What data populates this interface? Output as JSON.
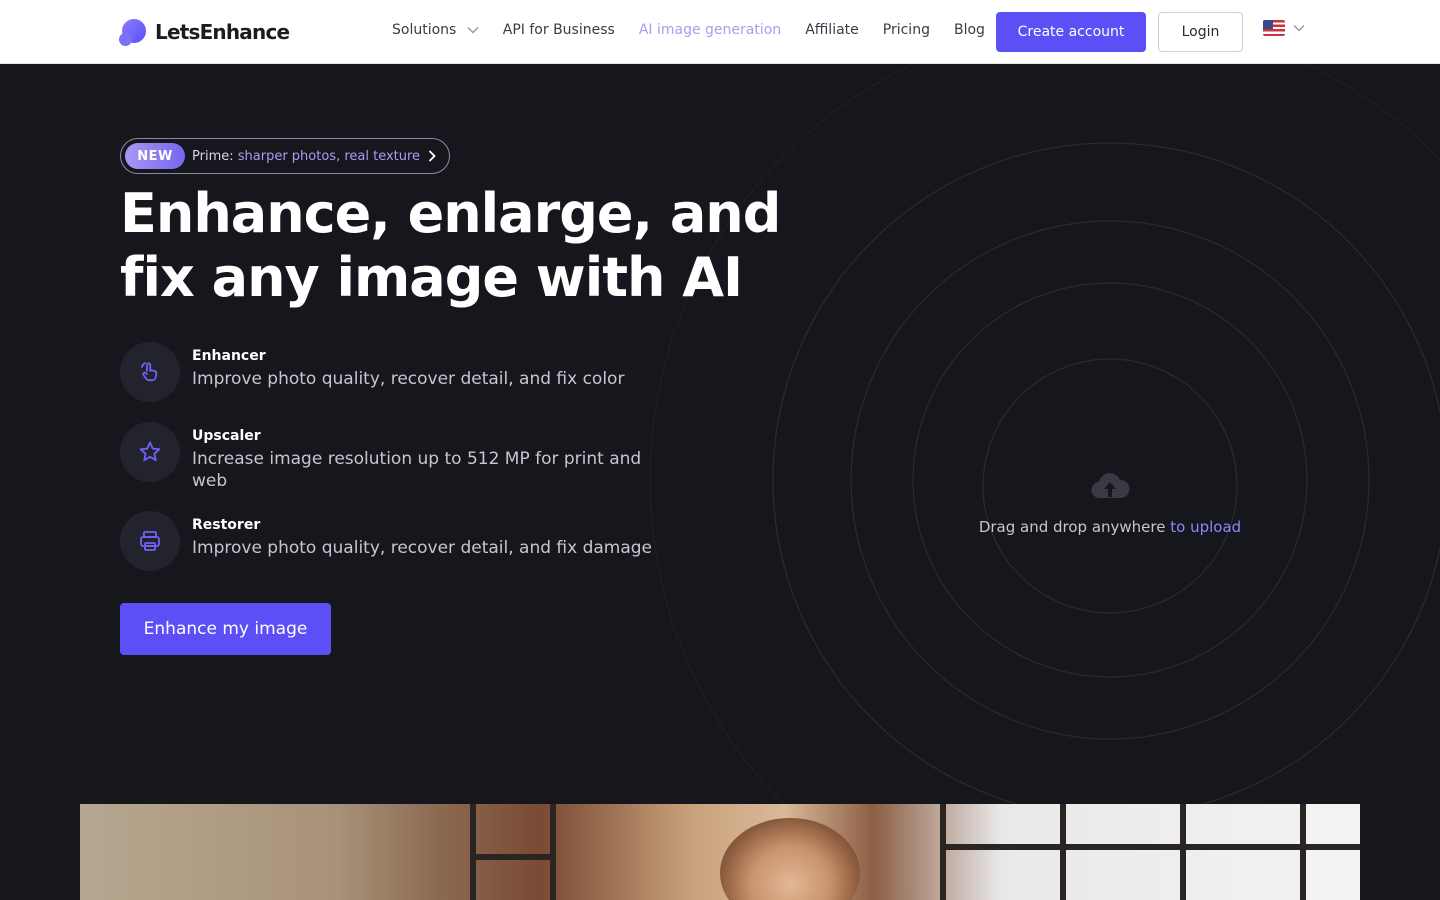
{
  "header": {
    "brand": "LetsEnhance",
    "nav": [
      {
        "label": "Solutions",
        "has_dropdown": true
      },
      {
        "label": "API for Business"
      },
      {
        "label": "AI image generation",
        "highlight": true
      },
      {
        "label": "Affiliate"
      },
      {
        "label": "Pricing"
      },
      {
        "label": "Blog"
      }
    ],
    "create_account": "Create account",
    "login": "Login",
    "language_icon": "us-flag-icon"
  },
  "hero": {
    "badge": {
      "tag": "NEW",
      "prefix": "Prime: ",
      "text": "sharper photos, real texture"
    },
    "headline": "Enhance, enlarge, and fix any image with AI",
    "features": [
      {
        "icon": "hand-pointer-icon",
        "title": "Enhancer",
        "description": "Improve photo quality, recover detail, and fix color"
      },
      {
        "icon": "star-icon",
        "title": "Upscaler",
        "description": "Increase image resolution up to 512 MP for print and web"
      },
      {
        "icon": "printer-icon",
        "title": "Restorer",
        "description": "Improve photo quality, recover detail, and fix damage"
      }
    ],
    "cta": "Enhance my image"
  },
  "upload": {
    "icon": "cloud-upload-icon",
    "text": "Drag and drop anywhere",
    "link": "to upload"
  },
  "colors": {
    "accent": "#5b4ff5",
    "background": "#16171c",
    "nav_highlight": "#a99cf0"
  }
}
